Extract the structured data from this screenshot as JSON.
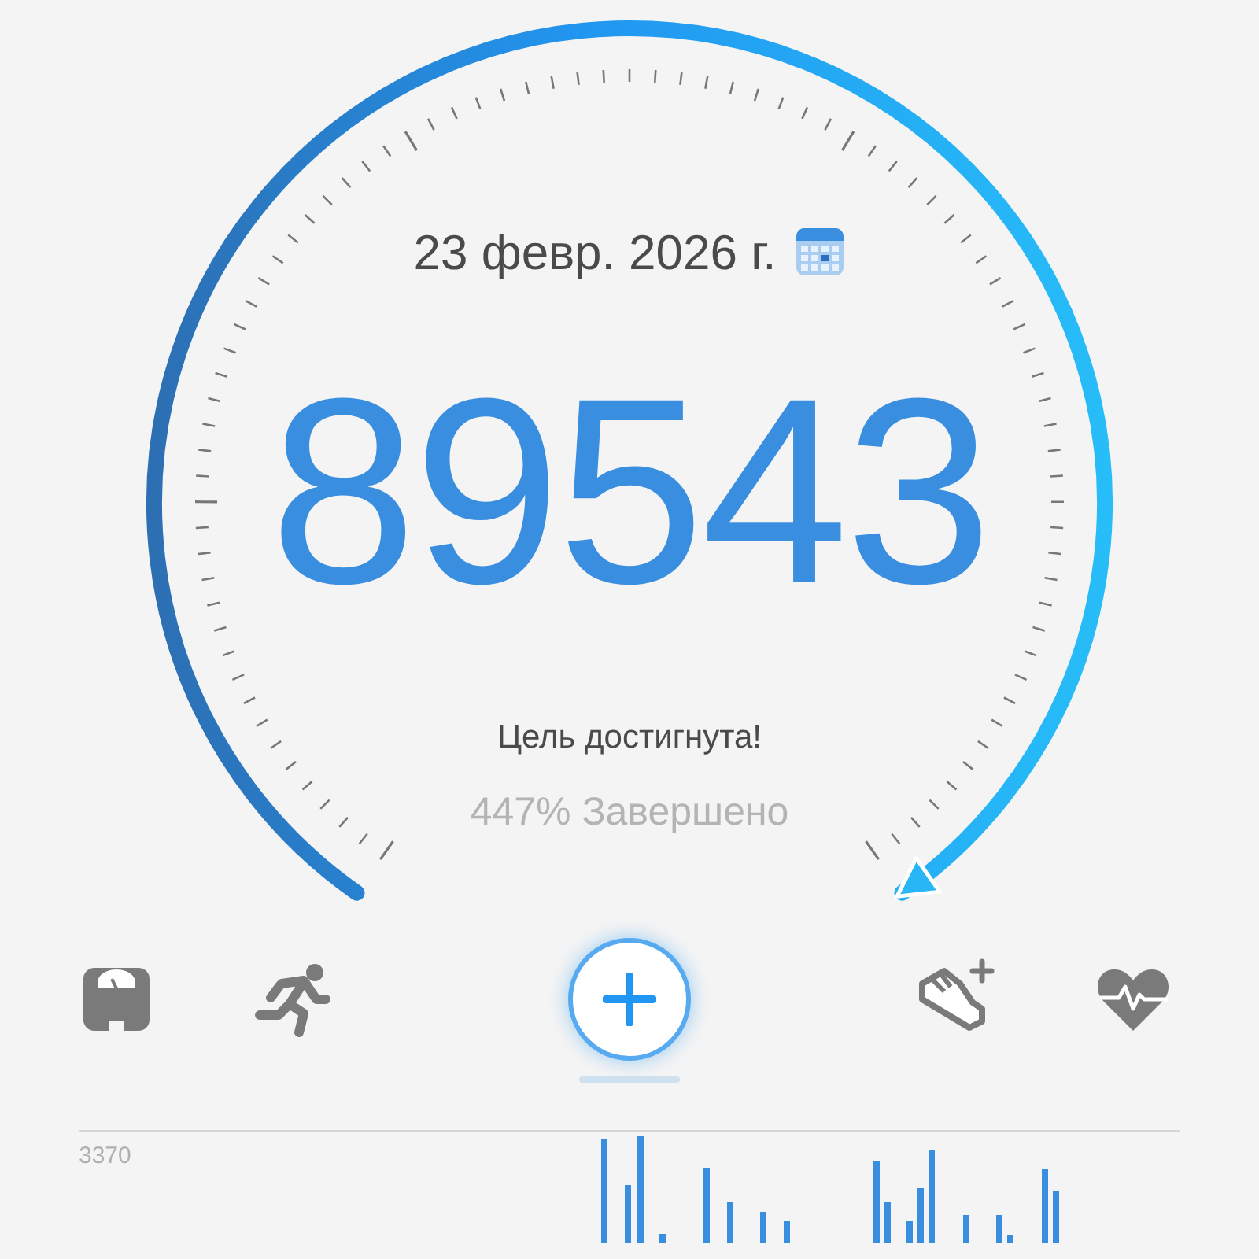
{
  "gauge": {
    "date": "23 февр. 2026 г.",
    "steps": "89543",
    "status": "Цель достигнута!",
    "percent": "447% Завершено"
  },
  "chart": {
    "top_label": "3370"
  }
}
